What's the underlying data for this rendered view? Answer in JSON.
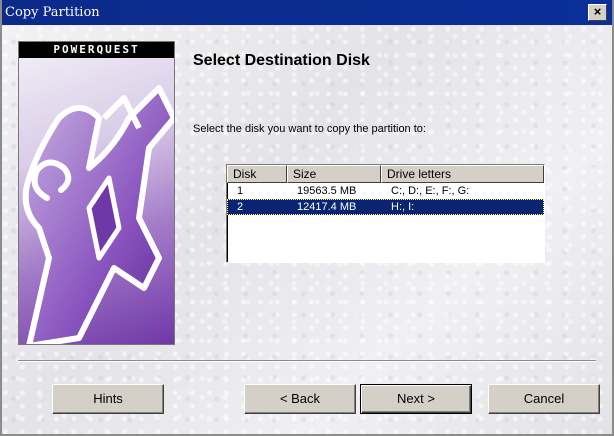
{
  "window": {
    "title": "Copy Partition",
    "close_symbol": "×"
  },
  "logo": {
    "brand": "POWERQUEST"
  },
  "heading": "Select Destination Disk",
  "prompt": "Select the disk you want to copy the partition to:",
  "table": {
    "columns": [
      "Disk",
      "Size",
      "Drive letters"
    ],
    "rows": [
      {
        "disk": "1",
        "size": "19563.5 MB",
        "letters": "C:, D:, E:, F:, G:",
        "selected": false
      },
      {
        "disk": "2",
        "size": "12417.4 MB",
        "letters": "H:, I:",
        "selected": true
      }
    ]
  },
  "buttons": {
    "hints": "Hints",
    "back": "< Back",
    "next": "Next >",
    "cancel": "Cancel"
  },
  "colors": {
    "titlebar": "#0b2a8a",
    "selection": "#0a2472",
    "logo_purple": "#6f38a8"
  }
}
